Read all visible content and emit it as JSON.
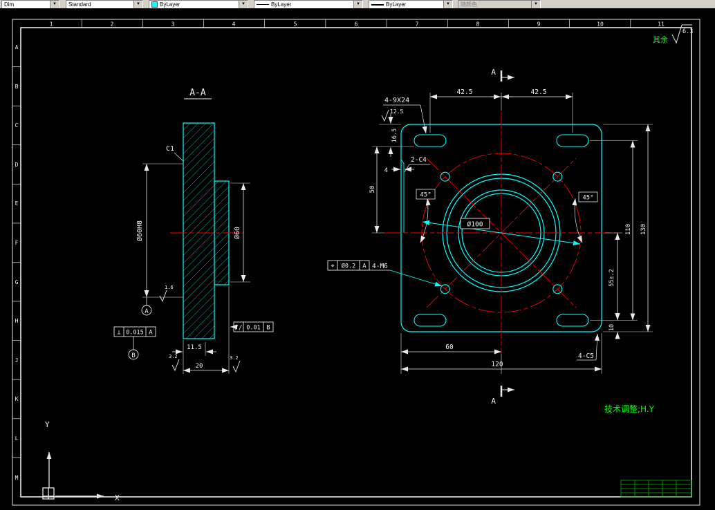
{
  "toolbar": {
    "dim_style": "Dim",
    "text_style": "Standard",
    "color": "ByLayer",
    "linetype": "ByLayer",
    "lineweight": "ByLayer",
    "plot_style": "随颜色"
  },
  "frame": {
    "zone_letters": [
      "A",
      "B",
      "C",
      "D",
      "E",
      "F",
      "G",
      "H",
      "J",
      "K",
      "L",
      "M"
    ],
    "zone_numbers": [
      "1",
      "2",
      "3",
      "4",
      "5",
      "6",
      "7",
      "8",
      "9",
      "10",
      "11"
    ]
  },
  "section_view": {
    "title": "A-A",
    "chamfer": "C1",
    "bore_dia": "Ø60H8",
    "hub_dia": "Ø60",
    "fcf_perp": {
      "sym": "⊥",
      "tol": "0.015",
      "datum": "A"
    },
    "fcf_par": {
      "sym": "//",
      "tol": "0.01",
      "datum": "B"
    },
    "datum_a": "A",
    "datum_b": "B",
    "dim_thickness": "11.5",
    "dim_width": "20",
    "rough_face": "1.6",
    "rough_left": "3.2",
    "rough_right": "3.2"
  },
  "plan_view": {
    "dim_pitch_left": "42.5",
    "dim_pitch_right": "42.5",
    "slot_callout": "4-9X24",
    "slot_rough": "12.5",
    "dim_edge": "16.5",
    "dim_50": "50",
    "dim_step": "4",
    "bore_chamfer": "2-C4",
    "angle_left": "45°",
    "angle_right": "45°",
    "bolt_circle": "Ø100",
    "fcf_pos": {
      "sym": "⌖",
      "tol": "Ø0.2",
      "datum": "A"
    },
    "thread_callout": "4-M6",
    "dim_110": "110",
    "dim_130": "130",
    "dim_55": "55±.2",
    "dim_10": "10",
    "dim_60": "60",
    "dim_120": "120",
    "corner_chamfer": "4-C5",
    "section_mark_top": "A",
    "section_mark_bottom": "A"
  },
  "notes": {
    "rest_label": "其余",
    "rest_value": "6.3",
    "signature": "技术调整;H.Y"
  },
  "ucs": {
    "x": "X",
    "y": "Y"
  },
  "colors": {
    "geometry": "#00ffff",
    "centerline": "#ff0000",
    "annotation": "#f0f0f0",
    "note": "#00ff00"
  }
}
